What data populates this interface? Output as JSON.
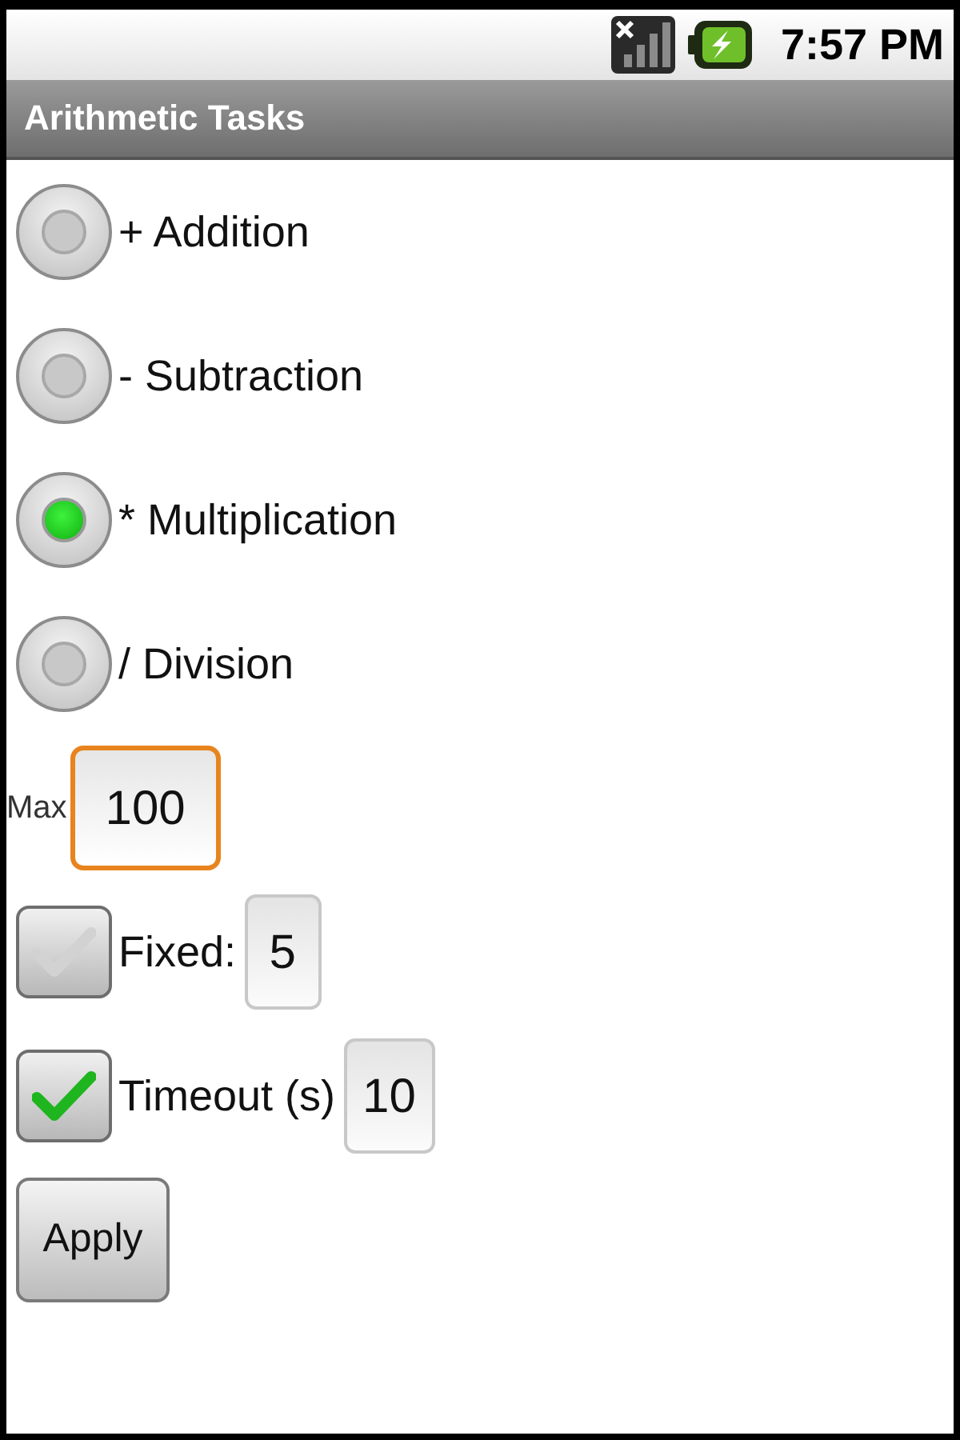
{
  "status_bar": {
    "time": "7:57 PM"
  },
  "title_bar": {
    "title": "Arithmetic Tasks"
  },
  "operations": [
    {
      "label": "+ Addition",
      "selected": false
    },
    {
      "label": "- Subtraction",
      "selected": false
    },
    {
      "label": "* Multiplication",
      "selected": true
    },
    {
      "label": "/ Division",
      "selected": false
    }
  ],
  "max": {
    "label": "Max",
    "value": "100",
    "focused": true
  },
  "options": [
    {
      "label": "Fixed:",
      "checked": false,
      "value": "5"
    },
    {
      "label": "Timeout (s)",
      "checked": true,
      "value": "10"
    }
  ],
  "apply_button": {
    "label": "Apply"
  }
}
